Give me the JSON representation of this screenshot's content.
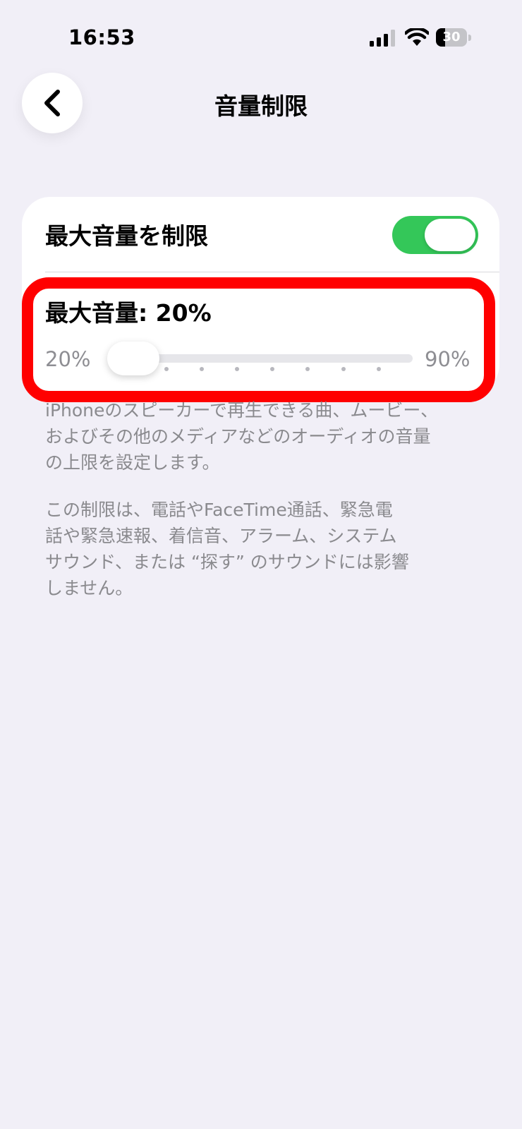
{
  "status_bar": {
    "time": "16:53",
    "battery": "30",
    "battery_level": 0.3
  },
  "nav": {
    "title": "音量制限"
  },
  "limit_toggle": {
    "label": "最大音量を制限",
    "on": true
  },
  "volume": {
    "label": "最大音量: 20%",
    "min_label": "20%",
    "max_label": "90%",
    "value": 20,
    "min": 20,
    "max": 90,
    "step": 10
  },
  "footer": {
    "paragraph1": "iPhoneのスピーカーで再生できる曲、ムービー、\nおよびその他のメディアなどのオーディオの音量\nの上限を設定します。",
    "paragraph2": "この制限は、電話やFaceTime通話、緊急電\n話や緊急速報、着信音、アラーム、システム\nサウンド、または “探す” のサウンドには影響\nしません。"
  },
  "colors": {
    "background": "#f1eff7",
    "toggle_on": "#34c759",
    "highlight": "#ff0000",
    "secondary_text": "#8a8a8e"
  },
  "icons": {
    "back": "chevron-left-icon",
    "signal": "cellular-signal-icon",
    "wifi": "wifi-icon",
    "battery": "battery-icon"
  }
}
